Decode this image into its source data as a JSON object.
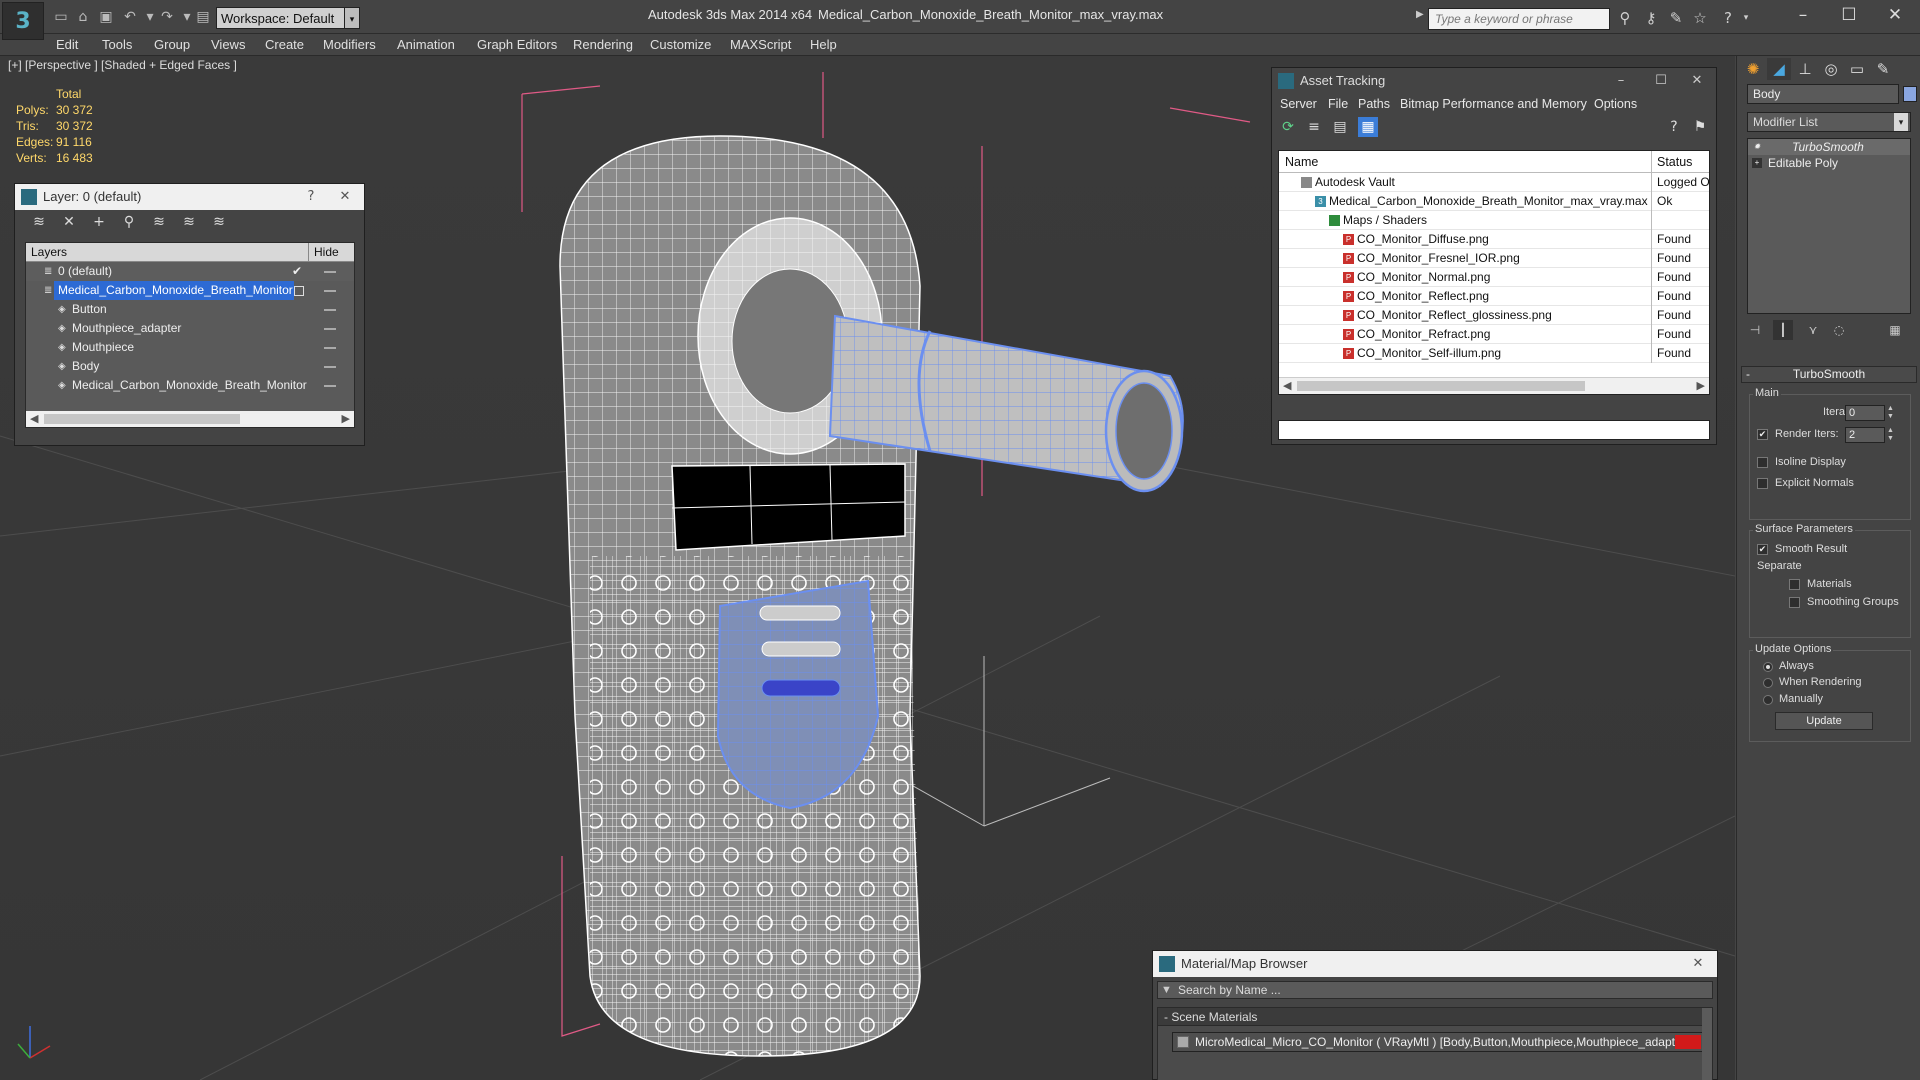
{
  "titlebar": {
    "app": "Autodesk 3ds Max  2014 x64",
    "document": "Medical_Carbon_Monoxide_Breath_Monitor_max_vray.max",
    "workspace": "Workspace: Default",
    "search_placeholder": "Type a keyword or phrase",
    "window_controls": [
      "minimize-icon",
      "maximize-icon",
      "close-icon"
    ]
  },
  "menu": [
    "Edit",
    "Tools",
    "Group",
    "Views",
    "Create",
    "Modifiers",
    "Animation",
    "Graph Editors",
    "Rendering",
    "Customize",
    "MAXScript",
    "Help"
  ],
  "viewport": {
    "label": "[+] [Perspective ] [Shaded + Edged Faces ]",
    "stats": {
      "header": "Total",
      "rows": [
        {
          "label": "Polys:",
          "value": "30 372"
        },
        {
          "label": "Tris:",
          "value": "30 372"
        },
        {
          "label": "Edges:",
          "value": "91 116"
        },
        {
          "label": "Verts:",
          "value": "16 483"
        }
      ]
    },
    "colors": {
      "wireframe": "#ffffff",
      "selection": "#6b8ff0",
      "bounds": "#e05a86"
    }
  },
  "layer_window": {
    "title": "Layer: 0 (default)",
    "help": "?",
    "columns": {
      "layers": "Layers",
      "hide": "Hide"
    },
    "rows": [
      {
        "name": "0 (default)",
        "level": 1,
        "icon": "layer-icon",
        "checked": true
      },
      {
        "name": "Medical_Carbon_Monoxide_Breath_Monitor",
        "level": 1,
        "icon": "layer-icon",
        "selected": true
      },
      {
        "name": "Button",
        "level": 2,
        "icon": "object-icon"
      },
      {
        "name": "Mouthpiece_adapter",
        "level": 2,
        "icon": "object-icon"
      },
      {
        "name": "Mouthpiece",
        "level": 2,
        "icon": "object-icon"
      },
      {
        "name": "Body",
        "level": 2,
        "icon": "object-icon"
      },
      {
        "name": "Medical_Carbon_Monoxide_Breath_Monitor",
        "level": 2,
        "icon": "object-icon"
      }
    ]
  },
  "asset_tracking": {
    "title": "Asset Tracking",
    "menu": [
      "Server",
      "File",
      "Paths",
      "Bitmap Performance and Memory",
      "Options"
    ],
    "columns": {
      "name": "Name",
      "status": "Status"
    },
    "rows": [
      {
        "name": "Autodesk Vault",
        "status": "Logged Ou",
        "level": 1,
        "icon": "vault"
      },
      {
        "name": "Medical_Carbon_Monoxide_Breath_Monitor_max_vray.max",
        "status": "Ok",
        "level": 2,
        "icon": "max"
      },
      {
        "name": "Maps / Shaders",
        "status": "",
        "level": 3,
        "icon": "folder"
      },
      {
        "name": "CO_Monitor_Diffuse.png",
        "status": "Found",
        "level": 4,
        "icon": "png"
      },
      {
        "name": "CO_Monitor_Fresnel_IOR.png",
        "status": "Found",
        "level": 4,
        "icon": "png"
      },
      {
        "name": "CO_Monitor_Normal.png",
        "status": "Found",
        "level": 4,
        "icon": "png"
      },
      {
        "name": "CO_Monitor_Reflect.png",
        "status": "Found",
        "level": 4,
        "icon": "png"
      },
      {
        "name": "CO_Monitor_Reflect_glossiness.png",
        "status": "Found",
        "level": 4,
        "icon": "png"
      },
      {
        "name": "CO_Monitor_Refract.png",
        "status": "Found",
        "level": 4,
        "icon": "png"
      },
      {
        "name": "CO_Monitor_Self-illum.png",
        "status": "Found",
        "level": 4,
        "icon": "png"
      }
    ]
  },
  "material_browser": {
    "title": "Material/Map Browser",
    "search_placeholder": "Search by Name ...",
    "group": "Scene Materials",
    "group_toggle": "-",
    "item": "MicroMedical_Micro_CO_Monitor  ( VRayMtl ) [Body,Button,Mouthpiece,Mouthpiece_adapter]",
    "swatch_color": "#d21a1a"
  },
  "command_panel": {
    "object_name": "Body",
    "object_color": "#8aa6e0",
    "modifier_list": "Modifier List",
    "stack": [
      {
        "label": "TurboSmooth",
        "type": "modifier"
      },
      {
        "label": "Editable Poly",
        "type": "base"
      }
    ],
    "rollout": "TurboSmooth",
    "main_group": "Main",
    "iterations_label": "Iterations:",
    "iterations_value": "0",
    "render_iters_label": "Render Iters:",
    "render_iters_value": "2",
    "render_iters_checked": true,
    "isoline_label": "Isoline Display",
    "explicit_normals_label": "Explicit Normals",
    "surface_group": "Surface Parameters",
    "smooth_result_label": "Smooth Result",
    "separate_label": "Separate",
    "materials_label": "Materials",
    "smoothing_groups_label": "Smoothing Groups",
    "update_group": "Update Options",
    "update_options": [
      "Always",
      "When Rendering",
      "Manually"
    ],
    "update_selected": "Always",
    "update_button": "Update"
  }
}
